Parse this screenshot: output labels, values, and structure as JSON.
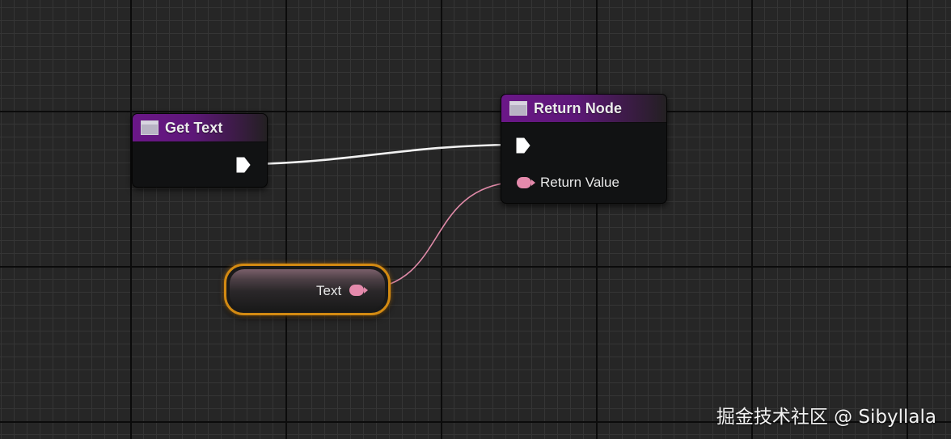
{
  "nodes": {
    "get_text": {
      "title": "Get Text",
      "icon": "function-icon"
    },
    "return_node": {
      "title": "Return Node",
      "icon": "function-icon",
      "return_value_label": "Return Value"
    },
    "variable": {
      "label": "Text"
    }
  },
  "colors": {
    "header_purple": "#6b1788",
    "text_pin_pink": "#e58aac",
    "exec_white": "#ffffff",
    "selection_orange": "#d38a12",
    "grid_background": "#262626"
  },
  "watermark": "掘金技术社区 @ Sibyllala"
}
